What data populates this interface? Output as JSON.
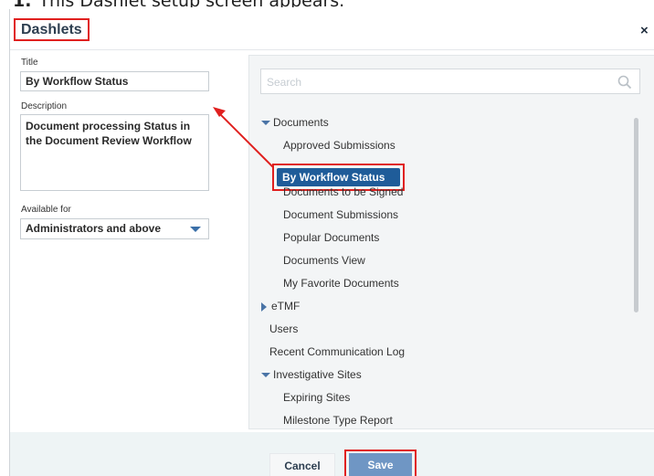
{
  "caption": {
    "number": "1.",
    "text": "This Dashlet setup screen appears."
  },
  "dialog": {
    "title": "Dashlets",
    "close_glyph": "×"
  },
  "form": {
    "title_label": "Title",
    "title_value": "By Workflow Status",
    "description_label": "Description",
    "description_value": "Document processing Status in the Document Review Workflow",
    "available_label": "Available for",
    "available_value": "Administrators and above"
  },
  "panel": {
    "search_placeholder": "Search",
    "items": [
      {
        "label": "Documents"
      },
      {
        "label": "Approved Submissions"
      },
      {
        "label": "By Workflow Status"
      },
      {
        "label": "Documents to be Signed"
      },
      {
        "label": "Document Submissions"
      },
      {
        "label": "Popular Documents"
      },
      {
        "label": "Documents View"
      },
      {
        "label": "My Favorite Documents"
      },
      {
        "label": "eTMF"
      },
      {
        "label": "Users"
      },
      {
        "label": "Recent Communication Log"
      },
      {
        "label": "Investigative Sites"
      },
      {
        "label": "Expiring Sites"
      },
      {
        "label": "Milestone Type Report"
      }
    ]
  },
  "footer": {
    "cancel_label": "Cancel",
    "save_label": "Save"
  },
  "colors": {
    "highlight": "#e0201f",
    "selected": "#1f5c99",
    "save": "#6f96c4"
  }
}
